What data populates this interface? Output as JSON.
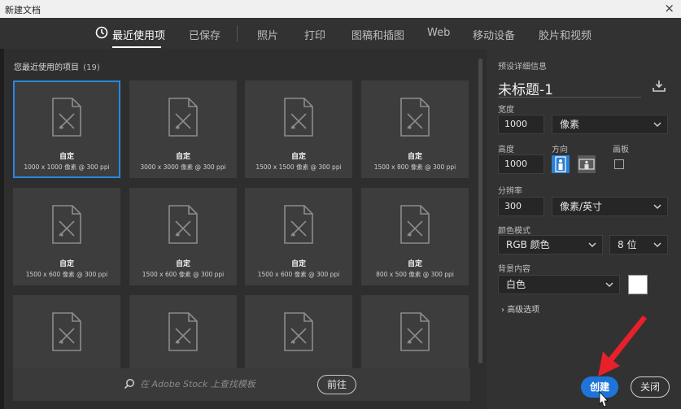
{
  "window": {
    "title": "新建文档",
    "close_glyph": "×"
  },
  "tabs": [
    {
      "label": "最近使用项",
      "icon": "clock-icon",
      "active": true
    },
    {
      "label": "已保存"
    },
    {
      "label": "照片"
    },
    {
      "label": "打印"
    },
    {
      "label": "图稿和插图"
    },
    {
      "label": "Web"
    },
    {
      "label": "移动设备"
    },
    {
      "label": "胶片和视频"
    }
  ],
  "recent": {
    "title": "您最近使用的项目",
    "count": "(19)",
    "items": [
      {
        "name": "自定",
        "spec": "1000 x 1000 像素 @ 300 ppi",
        "selected": true
      },
      {
        "name": "自定",
        "spec": "3000 x 3000 像素 @ 300 ppi"
      },
      {
        "name": "自定",
        "spec": "1500 x 1500 像素 @ 300 ppi"
      },
      {
        "name": "自定",
        "spec": "1500 x 800 像素 @ 300 ppi"
      },
      {
        "name": "自定",
        "spec": "1500 x 600 像素 @ 300 ppi"
      },
      {
        "name": "自定",
        "spec": "1500 x 600 像素 @ 300 ppi"
      },
      {
        "name": "自定",
        "spec": "1500 x 600 像素 @ 300 ppi"
      },
      {
        "name": "自定",
        "spec": "800 x 500 像素 @ 300 ppi"
      },
      {
        "name": "",
        "spec": ""
      },
      {
        "name": "",
        "spec": ""
      },
      {
        "name": "",
        "spec": ""
      },
      {
        "name": "",
        "spec": ""
      }
    ]
  },
  "search": {
    "placeholder": "在 Adobe Stock 上查找模板",
    "go_label": "前往"
  },
  "preset": {
    "section_label": "预设详细信息",
    "doc_title": "未标题-1",
    "width_label": "宽度",
    "width_value": "1000",
    "width_unit": "像素",
    "height_label": "高度",
    "height_value": "1000",
    "orientation_label": "方向",
    "artboard_label": "画板",
    "resolution_label": "分辨率",
    "resolution_value": "300",
    "resolution_unit": "像素/英寸",
    "color_mode_label": "颜色模式",
    "color_mode": "RGB 颜色",
    "bit_depth": "8 位",
    "background_label": "背景内容",
    "background": "白色",
    "background_swatch": "#ffffff",
    "advanced_label": "高级选项"
  },
  "buttons": {
    "create": "创建",
    "close": "关闭"
  },
  "colors": {
    "accent": "#1e74d8",
    "selected_outline": "#2a86e0",
    "annotation_arrow": "#e8202a"
  }
}
